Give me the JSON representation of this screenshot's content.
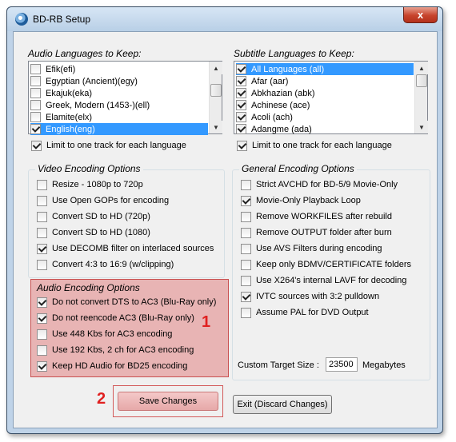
{
  "window": {
    "title": "BD-RB Setup",
    "close_glyph": "x"
  },
  "audio_lang": {
    "label": "Audio Languages to Keep:",
    "items": [
      {
        "label": "Efik(efi)",
        "checked": false,
        "selected": false
      },
      {
        "label": "Egyptian (Ancient)(egy)",
        "checked": false,
        "selected": false
      },
      {
        "label": "Ekajuk(eka)",
        "checked": false,
        "selected": false
      },
      {
        "label": "Greek, Modern (1453-)(ell)",
        "checked": false,
        "selected": false
      },
      {
        "label": "Elamite(elx)",
        "checked": false,
        "selected": false
      },
      {
        "label": "English(eng)",
        "checked": true,
        "selected": true
      }
    ],
    "limit_label": "Limit to one track for each language",
    "limit_checked": true
  },
  "subtitle_lang": {
    "label": "Subtitle Languages to Keep:",
    "items": [
      {
        "label": "All Languages (all)",
        "checked": true,
        "selected": true
      },
      {
        "label": "Afar (aar)",
        "checked": true,
        "selected": false
      },
      {
        "label": "Abkhazian (abk)",
        "checked": true,
        "selected": false
      },
      {
        "label": "Achinese (ace)",
        "checked": true,
        "selected": false
      },
      {
        "label": "Acoli (ach)",
        "checked": true,
        "selected": false
      },
      {
        "label": "Adangme (ada)",
        "checked": true,
        "selected": false
      }
    ],
    "limit_label": "Limit to one track for each language",
    "limit_checked": true
  },
  "video_opts": {
    "title": "Video Encoding Options",
    "items": [
      {
        "label": "Resize  - 1080p to 720p",
        "checked": false
      },
      {
        "label": "Use Open GOPs for encoding",
        "checked": false
      },
      {
        "label": "Convert SD to HD (720p)",
        "checked": false
      },
      {
        "label": "Convert SD to HD (1080)",
        "checked": false
      },
      {
        "label": "Use DECOMB filter on interlaced sources",
        "checked": true
      },
      {
        "label": "Convert 4:3 to 16:9 (w/clipping)",
        "checked": false
      }
    ]
  },
  "audio_opts": {
    "title": "Audio Encoding Options",
    "items": [
      {
        "label": "Do not convert DTS to AC3  (Blu-Ray only)",
        "checked": true
      },
      {
        "label": "Do not reencode AC3  (Blu-Ray only)",
        "checked": true
      },
      {
        "label": "Use 448 Kbs for AC3 encoding",
        "checked": false
      },
      {
        "label": "Use 192 Kbs, 2 ch for AC3 encoding",
        "checked": false
      },
      {
        "label": "Keep HD Audio for BD25 encoding",
        "checked": true
      }
    ]
  },
  "general_opts": {
    "title": "General Encoding Options",
    "items": [
      {
        "label": "Strict AVCHD for BD-5/9 Movie-Only",
        "checked": false
      },
      {
        "label": "Movie-Only Playback Loop",
        "checked": true
      },
      {
        "label": "Remove WORKFILES after rebuild",
        "checked": false
      },
      {
        "label": "Remove OUTPUT folder after burn",
        "checked": false
      },
      {
        "label": "Use AVS Filters during encoding",
        "checked": false
      },
      {
        "label": "Keep only BDMV/CERTIFICATE folders",
        "checked": false
      },
      {
        "label": "Use X264's internal LAVF for decoding",
        "checked": false
      },
      {
        "label": "IVTC sources with 3:2 pulldown",
        "checked": true
      },
      {
        "label": "Assume PAL for DVD Output",
        "checked": false
      }
    ],
    "target_label": "Custom Target Size :",
    "target_value": "23500",
    "target_unit": "Megabytes"
  },
  "annotations": {
    "one": "1",
    "two": "2",
    "color": "#e02020"
  },
  "buttons": {
    "save": "Save Changes",
    "exit": "Exit (Discard Changes)"
  }
}
